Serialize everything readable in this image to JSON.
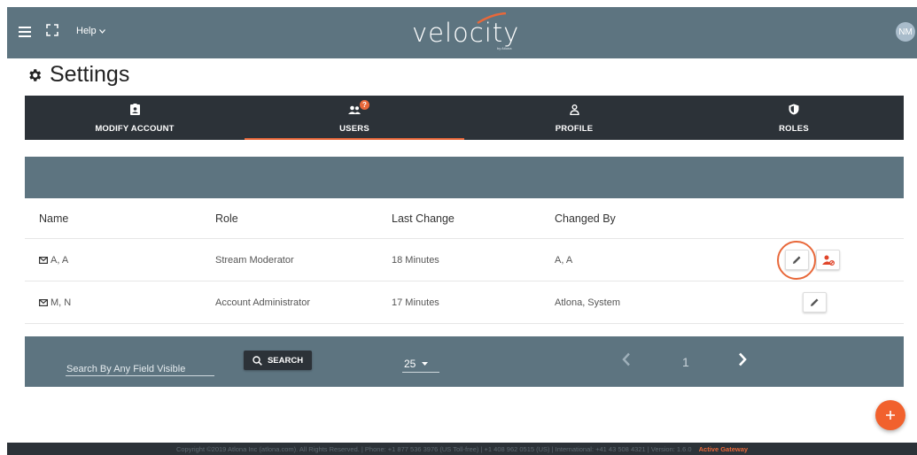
{
  "topbar": {
    "help_label": "Help",
    "logo_text": "velocity",
    "logo_sub": "by Atlona",
    "avatar_initials": "NM"
  },
  "page": {
    "title": "Settings"
  },
  "tabs": [
    {
      "label": "MODIFY ACCOUNT",
      "icon": "account-badge-icon",
      "active": false
    },
    {
      "label": "USERS",
      "icon": "users-icon",
      "active": true,
      "badge": "?"
    },
    {
      "label": "PROFILE",
      "icon": "profile-icon",
      "active": false
    },
    {
      "label": "ROLES",
      "icon": "shield-icon",
      "active": false
    }
  ],
  "table": {
    "columns": [
      "Name",
      "Role",
      "Last Change",
      "Changed By"
    ],
    "rows": [
      {
        "name": "A, A",
        "role": "Stream Moderator",
        "last_change": "18 Minutes",
        "changed_by": "A, A"
      },
      {
        "name": "M, N",
        "role": "Account Administrator",
        "last_change": "17 Minutes",
        "changed_by": "Atlona, System"
      }
    ]
  },
  "pager": {
    "search_placeholder": "Search By Any Field Visible",
    "search_button": "SEARCH",
    "per_page": "25",
    "current_page": "1"
  },
  "footer": {
    "copyright": "Copyright ©2019 Atlona Inc (atlona.com). All Rights Reserved. | Phone: +1 877 536 3976 (US Toll-free) | +1 408 962 0515 (US) | International: +41 43 508 4321 | Version: 1.6.0",
    "gateway": "Active Gateway"
  },
  "colors": {
    "header": "#5d7480",
    "tabs_bg": "#2c3238",
    "accent": "#e8683a"
  }
}
